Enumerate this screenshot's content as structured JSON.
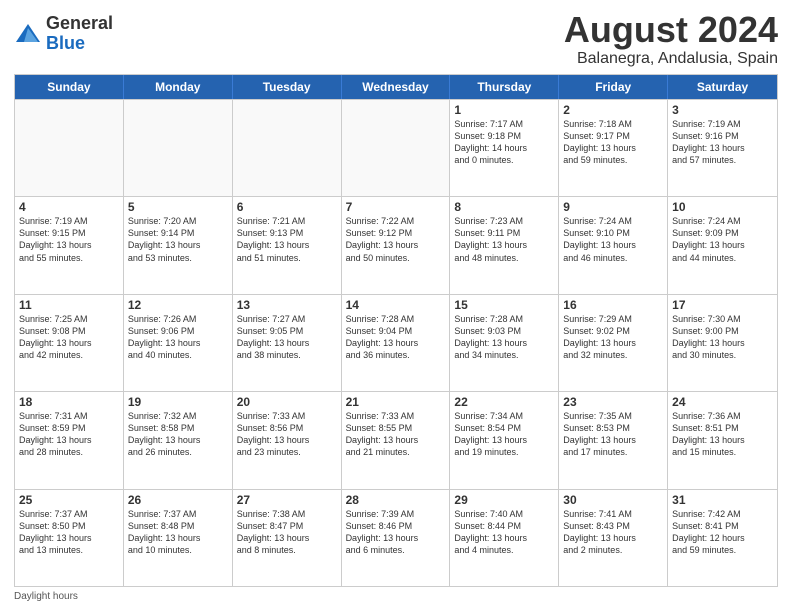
{
  "logo": {
    "general": "General",
    "blue": "Blue"
  },
  "title": "August 2024",
  "subtitle": "Balanegra, Andalusia, Spain",
  "days": [
    "Sunday",
    "Monday",
    "Tuesday",
    "Wednesday",
    "Thursday",
    "Friday",
    "Saturday"
  ],
  "footer": "Daylight hours",
  "weeks": [
    [
      {
        "day": "",
        "info": ""
      },
      {
        "day": "",
        "info": ""
      },
      {
        "day": "",
        "info": ""
      },
      {
        "day": "",
        "info": ""
      },
      {
        "day": "1",
        "info": "Sunrise: 7:17 AM\nSunset: 9:18 PM\nDaylight: 14 hours\nand 0 minutes."
      },
      {
        "day": "2",
        "info": "Sunrise: 7:18 AM\nSunset: 9:17 PM\nDaylight: 13 hours\nand 59 minutes."
      },
      {
        "day": "3",
        "info": "Sunrise: 7:19 AM\nSunset: 9:16 PM\nDaylight: 13 hours\nand 57 minutes."
      }
    ],
    [
      {
        "day": "4",
        "info": "Sunrise: 7:19 AM\nSunset: 9:15 PM\nDaylight: 13 hours\nand 55 minutes."
      },
      {
        "day": "5",
        "info": "Sunrise: 7:20 AM\nSunset: 9:14 PM\nDaylight: 13 hours\nand 53 minutes."
      },
      {
        "day": "6",
        "info": "Sunrise: 7:21 AM\nSunset: 9:13 PM\nDaylight: 13 hours\nand 51 minutes."
      },
      {
        "day": "7",
        "info": "Sunrise: 7:22 AM\nSunset: 9:12 PM\nDaylight: 13 hours\nand 50 minutes."
      },
      {
        "day": "8",
        "info": "Sunrise: 7:23 AM\nSunset: 9:11 PM\nDaylight: 13 hours\nand 48 minutes."
      },
      {
        "day": "9",
        "info": "Sunrise: 7:24 AM\nSunset: 9:10 PM\nDaylight: 13 hours\nand 46 minutes."
      },
      {
        "day": "10",
        "info": "Sunrise: 7:24 AM\nSunset: 9:09 PM\nDaylight: 13 hours\nand 44 minutes."
      }
    ],
    [
      {
        "day": "11",
        "info": "Sunrise: 7:25 AM\nSunset: 9:08 PM\nDaylight: 13 hours\nand 42 minutes."
      },
      {
        "day": "12",
        "info": "Sunrise: 7:26 AM\nSunset: 9:06 PM\nDaylight: 13 hours\nand 40 minutes."
      },
      {
        "day": "13",
        "info": "Sunrise: 7:27 AM\nSunset: 9:05 PM\nDaylight: 13 hours\nand 38 minutes."
      },
      {
        "day": "14",
        "info": "Sunrise: 7:28 AM\nSunset: 9:04 PM\nDaylight: 13 hours\nand 36 minutes."
      },
      {
        "day": "15",
        "info": "Sunrise: 7:28 AM\nSunset: 9:03 PM\nDaylight: 13 hours\nand 34 minutes."
      },
      {
        "day": "16",
        "info": "Sunrise: 7:29 AM\nSunset: 9:02 PM\nDaylight: 13 hours\nand 32 minutes."
      },
      {
        "day": "17",
        "info": "Sunrise: 7:30 AM\nSunset: 9:00 PM\nDaylight: 13 hours\nand 30 minutes."
      }
    ],
    [
      {
        "day": "18",
        "info": "Sunrise: 7:31 AM\nSunset: 8:59 PM\nDaylight: 13 hours\nand 28 minutes."
      },
      {
        "day": "19",
        "info": "Sunrise: 7:32 AM\nSunset: 8:58 PM\nDaylight: 13 hours\nand 26 minutes."
      },
      {
        "day": "20",
        "info": "Sunrise: 7:33 AM\nSunset: 8:56 PM\nDaylight: 13 hours\nand 23 minutes."
      },
      {
        "day": "21",
        "info": "Sunrise: 7:33 AM\nSunset: 8:55 PM\nDaylight: 13 hours\nand 21 minutes."
      },
      {
        "day": "22",
        "info": "Sunrise: 7:34 AM\nSunset: 8:54 PM\nDaylight: 13 hours\nand 19 minutes."
      },
      {
        "day": "23",
        "info": "Sunrise: 7:35 AM\nSunset: 8:53 PM\nDaylight: 13 hours\nand 17 minutes."
      },
      {
        "day": "24",
        "info": "Sunrise: 7:36 AM\nSunset: 8:51 PM\nDaylight: 13 hours\nand 15 minutes."
      }
    ],
    [
      {
        "day": "25",
        "info": "Sunrise: 7:37 AM\nSunset: 8:50 PM\nDaylight: 13 hours\nand 13 minutes."
      },
      {
        "day": "26",
        "info": "Sunrise: 7:37 AM\nSunset: 8:48 PM\nDaylight: 13 hours\nand 10 minutes."
      },
      {
        "day": "27",
        "info": "Sunrise: 7:38 AM\nSunset: 8:47 PM\nDaylight: 13 hours\nand 8 minutes."
      },
      {
        "day": "28",
        "info": "Sunrise: 7:39 AM\nSunset: 8:46 PM\nDaylight: 13 hours\nand 6 minutes."
      },
      {
        "day": "29",
        "info": "Sunrise: 7:40 AM\nSunset: 8:44 PM\nDaylight: 13 hours\nand 4 minutes."
      },
      {
        "day": "30",
        "info": "Sunrise: 7:41 AM\nSunset: 8:43 PM\nDaylight: 13 hours\nand 2 minutes."
      },
      {
        "day": "31",
        "info": "Sunrise: 7:42 AM\nSunset: 8:41 PM\nDaylight: 12 hours\nand 59 minutes."
      }
    ]
  ]
}
